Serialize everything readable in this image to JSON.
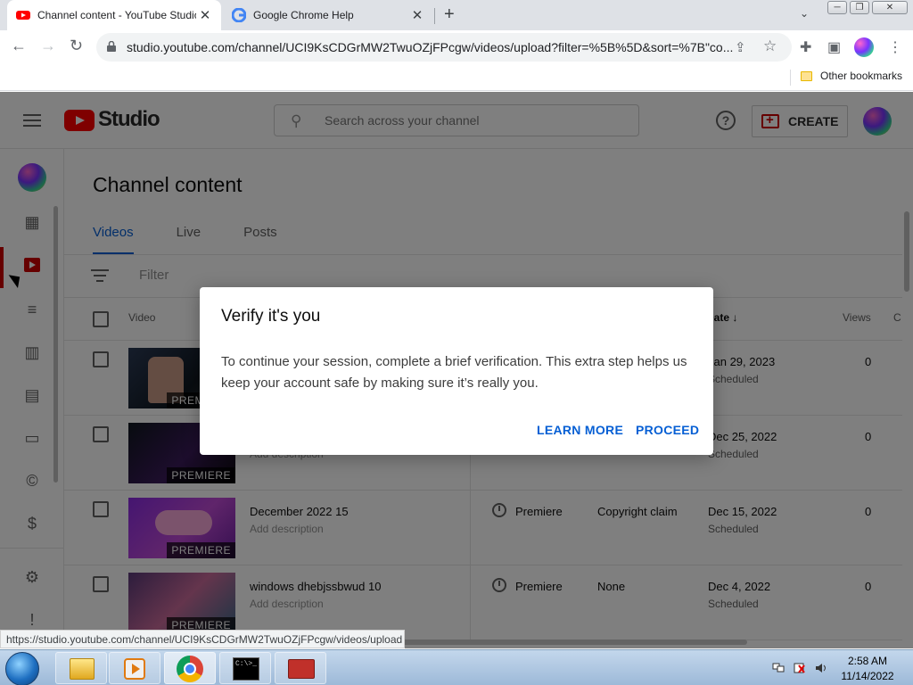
{
  "browser": {
    "tabs": [
      {
        "title": "Channel content - YouTube Studio"
      },
      {
        "title": "Google Chrome Help"
      }
    ],
    "url": "studio.youtube.com/channel/UCI9KsCDGrMW2TwuOZjFPcgw/videos/upload?filter=%5B%5D&sort=%7B\"co...",
    "bookmarks": {
      "other": "Other bookmarks"
    },
    "status_url": "https://studio.youtube.com/channel/UCI9KsCDGrMW2TwuOZjFPcgw/videos/upload"
  },
  "studio": {
    "brand": "Studio",
    "search_placeholder": "Search across your channel",
    "create_label": "CREATE",
    "help_glyph": "?",
    "page_title": "Channel content",
    "tabs": [
      {
        "label": "Videos"
      },
      {
        "label": "Live"
      },
      {
        "label": "Posts"
      }
    ],
    "filter_placeholder": "Filter",
    "columns": {
      "video": "Video",
      "date": "Date",
      "date_sort_glyph": "↓",
      "views": "Views",
      "comments": "C"
    },
    "rows": [
      {
        "title": "",
        "description": "",
        "visibility": "",
        "restrictions": "",
        "date": "Jan 29, 2023",
        "status": "Scheduled",
        "views": "0",
        "badge": "PREMIERE"
      },
      {
        "title": "",
        "description": "Add description",
        "visibility": "",
        "restrictions": "",
        "date": "Dec 25, 2022",
        "status": "Scheduled",
        "views": "0",
        "badge": "PREMIERE"
      },
      {
        "title": "December 2022 15",
        "description": "Add description",
        "visibility": "Premiere",
        "restrictions": "Copyright claim",
        "date": "Dec 15, 2022",
        "status": "Scheduled",
        "views": "0",
        "badge": "PREMIERE"
      },
      {
        "title": "windows dhebjssbwud 10",
        "description": "Add description",
        "visibility": "Premiere",
        "restrictions": "None",
        "date": "Dec 4, 2022",
        "status": "Scheduled",
        "views": "0",
        "badge": "PREMIERE"
      }
    ]
  },
  "dialog": {
    "title": "Verify it's you",
    "body": "To continue your session, complete a brief verification. This extra step helps us keep your account safe by making sure it’s really you.",
    "learn_more": "LEARN MORE",
    "proceed": "PROCEED"
  },
  "taskbar": {
    "time": "2:58 AM",
    "date": "11/14/2022",
    "cmd_text": "C:\\>_"
  },
  "colors": {
    "accent_blue": "#065fd4",
    "youtube_red": "#ff0000",
    "active_red": "#cc0000"
  }
}
